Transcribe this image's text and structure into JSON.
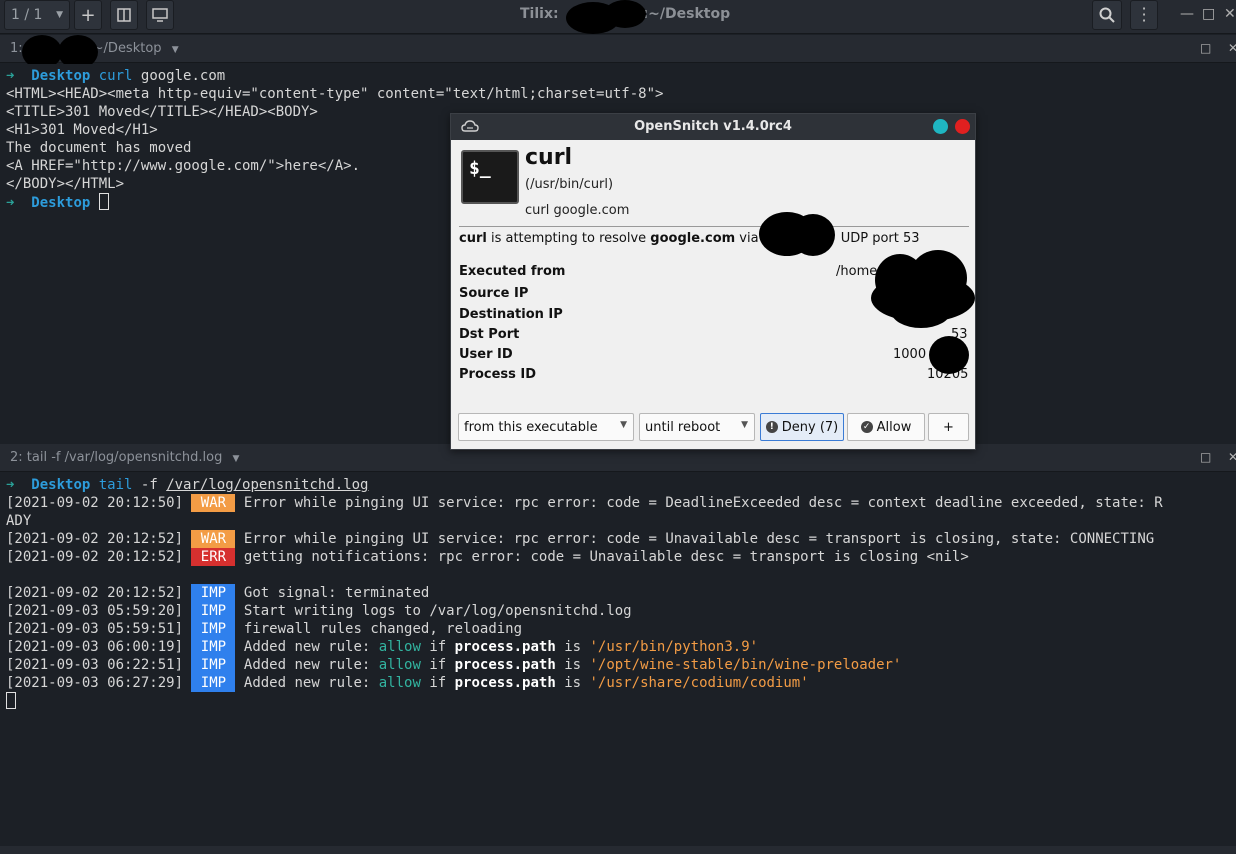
{
  "header": {
    "session_label": "1 / 1",
    "window_title": "Tilix:",
    "window_title_suffix": ":~/Desktop",
    "icons": [
      "chevron-down-icon",
      "plus-icon",
      "split-icon",
      "sync-input-icon",
      "search-icon",
      "kebab-menu-icon",
      "minimize-icon",
      "maximize-icon",
      "close-icon"
    ]
  },
  "term1": {
    "title_prefix": "1:",
    "title_suffix": "~/Desktop",
    "prompt_arrow": "➜",
    "prompt_dir": "Desktop",
    "cmd": "curl",
    "args": " google.com",
    "output": [
      "<HTML><HEAD><meta http-equiv=\"content-type\" content=\"text/html;charset=utf-8\">",
      "<TITLE>301 Moved</TITLE></HEAD><BODY>",
      "<H1>301 Moved</H1>",
      "The document has moved",
      "<A HREF=\"http://www.google.com/\">here</A>.",
      "</BODY></HTML>"
    ]
  },
  "term2": {
    "title": "2: tail -f /var/log/opensnitchd.log",
    "prompt_arrow": "➜",
    "prompt_dir": "Desktop",
    "cmd": "tail",
    "flag": " -f ",
    "file": "/var/log/opensnitchd.log",
    "logs": [
      {
        "ts": "[2021-09-02 20:12:50]",
        "level": "WAR",
        "msg": "Error while pinging UI service: rpc error: code = DeadlineExceeded desc = context deadline exceeded, state: R"
      },
      {
        "ts": "",
        "level": "",
        "msg": "ADY"
      },
      {
        "ts": "[2021-09-02 20:12:52]",
        "level": "WAR",
        "msg": "Error while pinging UI service: rpc error: code = Unavailable desc = transport is closing, state: CONNECTING"
      },
      {
        "ts": "[2021-09-02 20:12:52]",
        "level": "ERR",
        "msg": "getting notifications: rpc error: code = Unavailable desc = transport is closing <nil>"
      },
      {
        "ts": "[2021-09-02 20:12:52]",
        "level": "IMP",
        "msg": "Got signal: terminated"
      },
      {
        "ts": "[2021-09-03 05:59:20]",
        "level": "IMP",
        "msg": "Start writing logs to /var/log/opensnitchd.log"
      },
      {
        "ts": "[2021-09-03 05:59:51]",
        "level": "IMP",
        "msg": "firewall rules changed, reloading"
      }
    ],
    "rule_prefix": "Added new rule: ",
    "rule_allow": "allow",
    "rule_if": " if ",
    "rule_key": "process.path",
    "rule_is": " is ",
    "rules": [
      {
        "ts": "[2021-09-03 06:00:19]",
        "level": "IMP",
        "path": "'/usr/bin/python3.9'"
      },
      {
        "ts": "[2021-09-03 06:22:51]",
        "level": "IMP",
        "path": "'/opt/wine-stable/bin/wine-preloader'"
      },
      {
        "ts": "[2021-09-03 06:27:29]",
        "level": "IMP",
        "path": "'/usr/share/codium/codium'"
      }
    ]
  },
  "dialog": {
    "title": "OpenSnitch v1.4.0rc4",
    "app_icon_text": "$_",
    "app_name": "curl",
    "app_path": "(/usr/bin/curl)",
    "app_cmdline": "curl google.com",
    "msg_app": "curl",
    "msg_mid": " is attempting to resolve ",
    "msg_host": "google.com",
    "msg_via": " via ",
    "msg_tail": "UDP port 53",
    "labels": {
      "executed_from": "Executed from",
      "source_ip": "Source IP",
      "destination_ip": "Destination IP",
      "dst_port": "Dst Port",
      "user_id": "User ID",
      "process_id": "Process ID"
    },
    "values": {
      "executed_from": "/home",
      "dst_port": "53",
      "user_id": "1000",
      "process_id": "10205"
    },
    "scope_select": "from this executable",
    "duration_select": "until reboot",
    "deny_label": "Deny (7)",
    "allow_label": "Allow",
    "more_label": "+"
  }
}
